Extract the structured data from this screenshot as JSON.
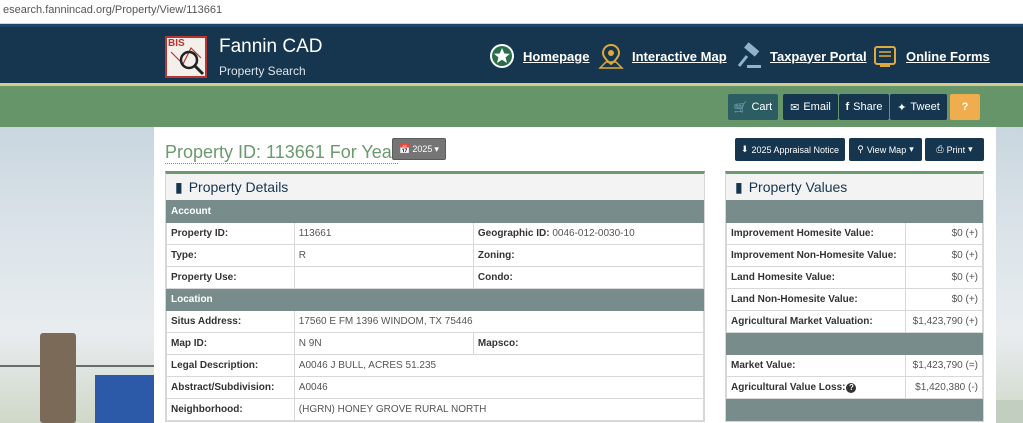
{
  "browser": {
    "url": "esearch.fannincad.org/Property/View/113661"
  },
  "header": {
    "logo_text": "BIS",
    "title": "Fannin CAD",
    "subtitle": "Property Search",
    "nav": [
      {
        "label": "Homepage",
        "icon": "star-badge-icon"
      },
      {
        "label": "Interactive Map",
        "icon": "map-pin-icon"
      },
      {
        "label": "Taxpayer Portal",
        "icon": "gavel-icon"
      },
      {
        "label": "Online Forms",
        "icon": "forms-icon"
      }
    ]
  },
  "toolbar": {
    "cart": "Cart",
    "email": "Email",
    "share": "Share",
    "tweet": "Tweet",
    "help": "?"
  },
  "property": {
    "title": "Property ID: 113661 For Year",
    "year": "2025",
    "appraisal_notice": "2025 Appraisal Notice",
    "view_map": "View Map",
    "print": "Print"
  },
  "details": {
    "heading": "Property Details",
    "account_section": "Account",
    "location_section": "Location",
    "labels": {
      "property_id": "Property ID:",
      "geographic_id": "Geographic ID:",
      "type": "Type:",
      "zoning": "Zoning:",
      "property_use": "Property Use:",
      "condo": "Condo:",
      "situs": "Situs Address:",
      "map_id": "Map ID:",
      "mapsco": "Mapsco:",
      "legal": "Legal Description:",
      "abstract": "Abstract/Subdivision:",
      "neighborhood": "Neighborhood:"
    },
    "values": {
      "property_id": "113661",
      "geographic_id": "0046-012-0030-10",
      "type": "R",
      "situs": "17560 E FM 1396 WINDOM, TX 75446",
      "map_id": "N 9N",
      "legal": "A0046 J BULL, ACRES 51.235",
      "abstract": "A0046",
      "neighborhood": "(HGRN) HONEY GROVE RURAL NORTH"
    }
  },
  "values_panel": {
    "heading": "Property Values",
    "rows": [
      {
        "label": "Improvement Homesite Value:",
        "value": "$0 (+)"
      },
      {
        "label": "Improvement Non-Homesite Value:",
        "value": "$0 (+)"
      },
      {
        "label": "Land Homesite Value:",
        "value": "$0 (+)"
      },
      {
        "label": "Land Non-Homesite Value:",
        "value": "$0 (+)"
      },
      {
        "label": "Agricultural Market Valuation:",
        "value": "$1,423,790 (+)"
      }
    ],
    "rows2": [
      {
        "label": "Market Value:",
        "value": "$1,423,790 (=)"
      },
      {
        "label": "Agricultural Value Loss:",
        "value": "$1,420,380 (-)"
      }
    ]
  },
  "colors": {
    "header_bg": "#16364f",
    "green_bar": "#66956a",
    "accent_green": "#6b9a6e",
    "section_gray": "#788c8c",
    "help_orange": "#f0ad4e"
  }
}
